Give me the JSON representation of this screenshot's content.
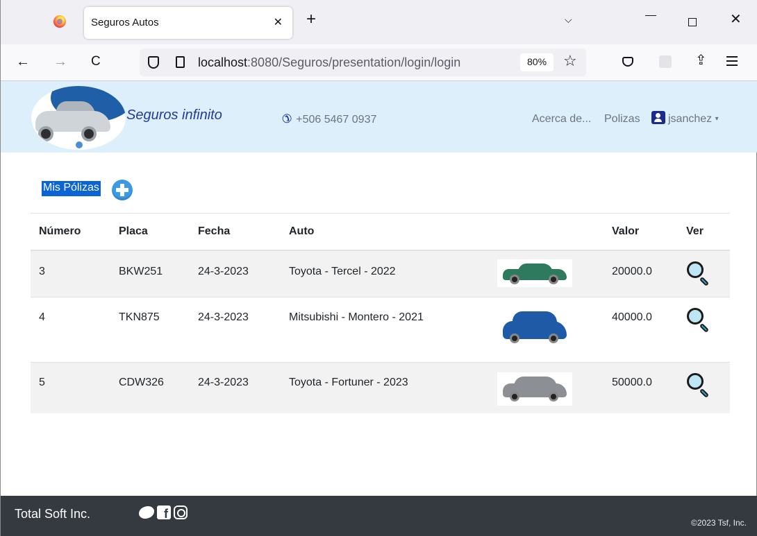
{
  "browser": {
    "tab_title": "Seguros Autos",
    "tab_close": "✕",
    "new_tab": "+",
    "tabs_menu": "⌵",
    "win_close": "✕",
    "back": "←",
    "forward": "→",
    "reload": "C",
    "url_host": "localhost",
    "url_rest": ":8080/Seguros/presentation/login/login",
    "zoom": "80%",
    "star": "☆",
    "share": "⇪"
  },
  "header": {
    "brand": "Seguros infinito",
    "phone_icon": "✆",
    "phone": "+506 5467 0937",
    "nav_about": "Acerca de...",
    "nav_policies": "Polizas",
    "user": "jsanchez",
    "user_caret": "▾"
  },
  "main": {
    "title": "Mis Pólizas",
    "columns": [
      "Número",
      "Placa",
      "Fecha",
      "Auto",
      "",
      "Valor",
      "Ver"
    ],
    "rows": [
      {
        "numero": "3",
        "placa": "BKW251",
        "fecha": "24-3-2023",
        "auto": "Toyota - Tercel - 2022",
        "valor": "20000.0",
        "car_color": "#2e7a5e"
      },
      {
        "numero": "4",
        "placa": "TKN875",
        "fecha": "24-3-2023",
        "auto": "Mitsubishi - Montero - 2021",
        "valor": "40000.0",
        "car_color": "#1f5aa6"
      },
      {
        "numero": "5",
        "placa": "CDW326",
        "fecha": "24-3-2023",
        "auto": "Toyota - Fortuner - 2023",
        "valor": "50000.0",
        "car_color": "#8c8f93"
      }
    ]
  },
  "footer": {
    "company": "Total Soft Inc.",
    "copyright": "©2023 Tsf, Inc."
  },
  "colors": {
    "header_bg": "#dceffb",
    "brand": "#213c9b",
    "footer_bg": "#343a40",
    "highlight": "#0a64d6"
  }
}
